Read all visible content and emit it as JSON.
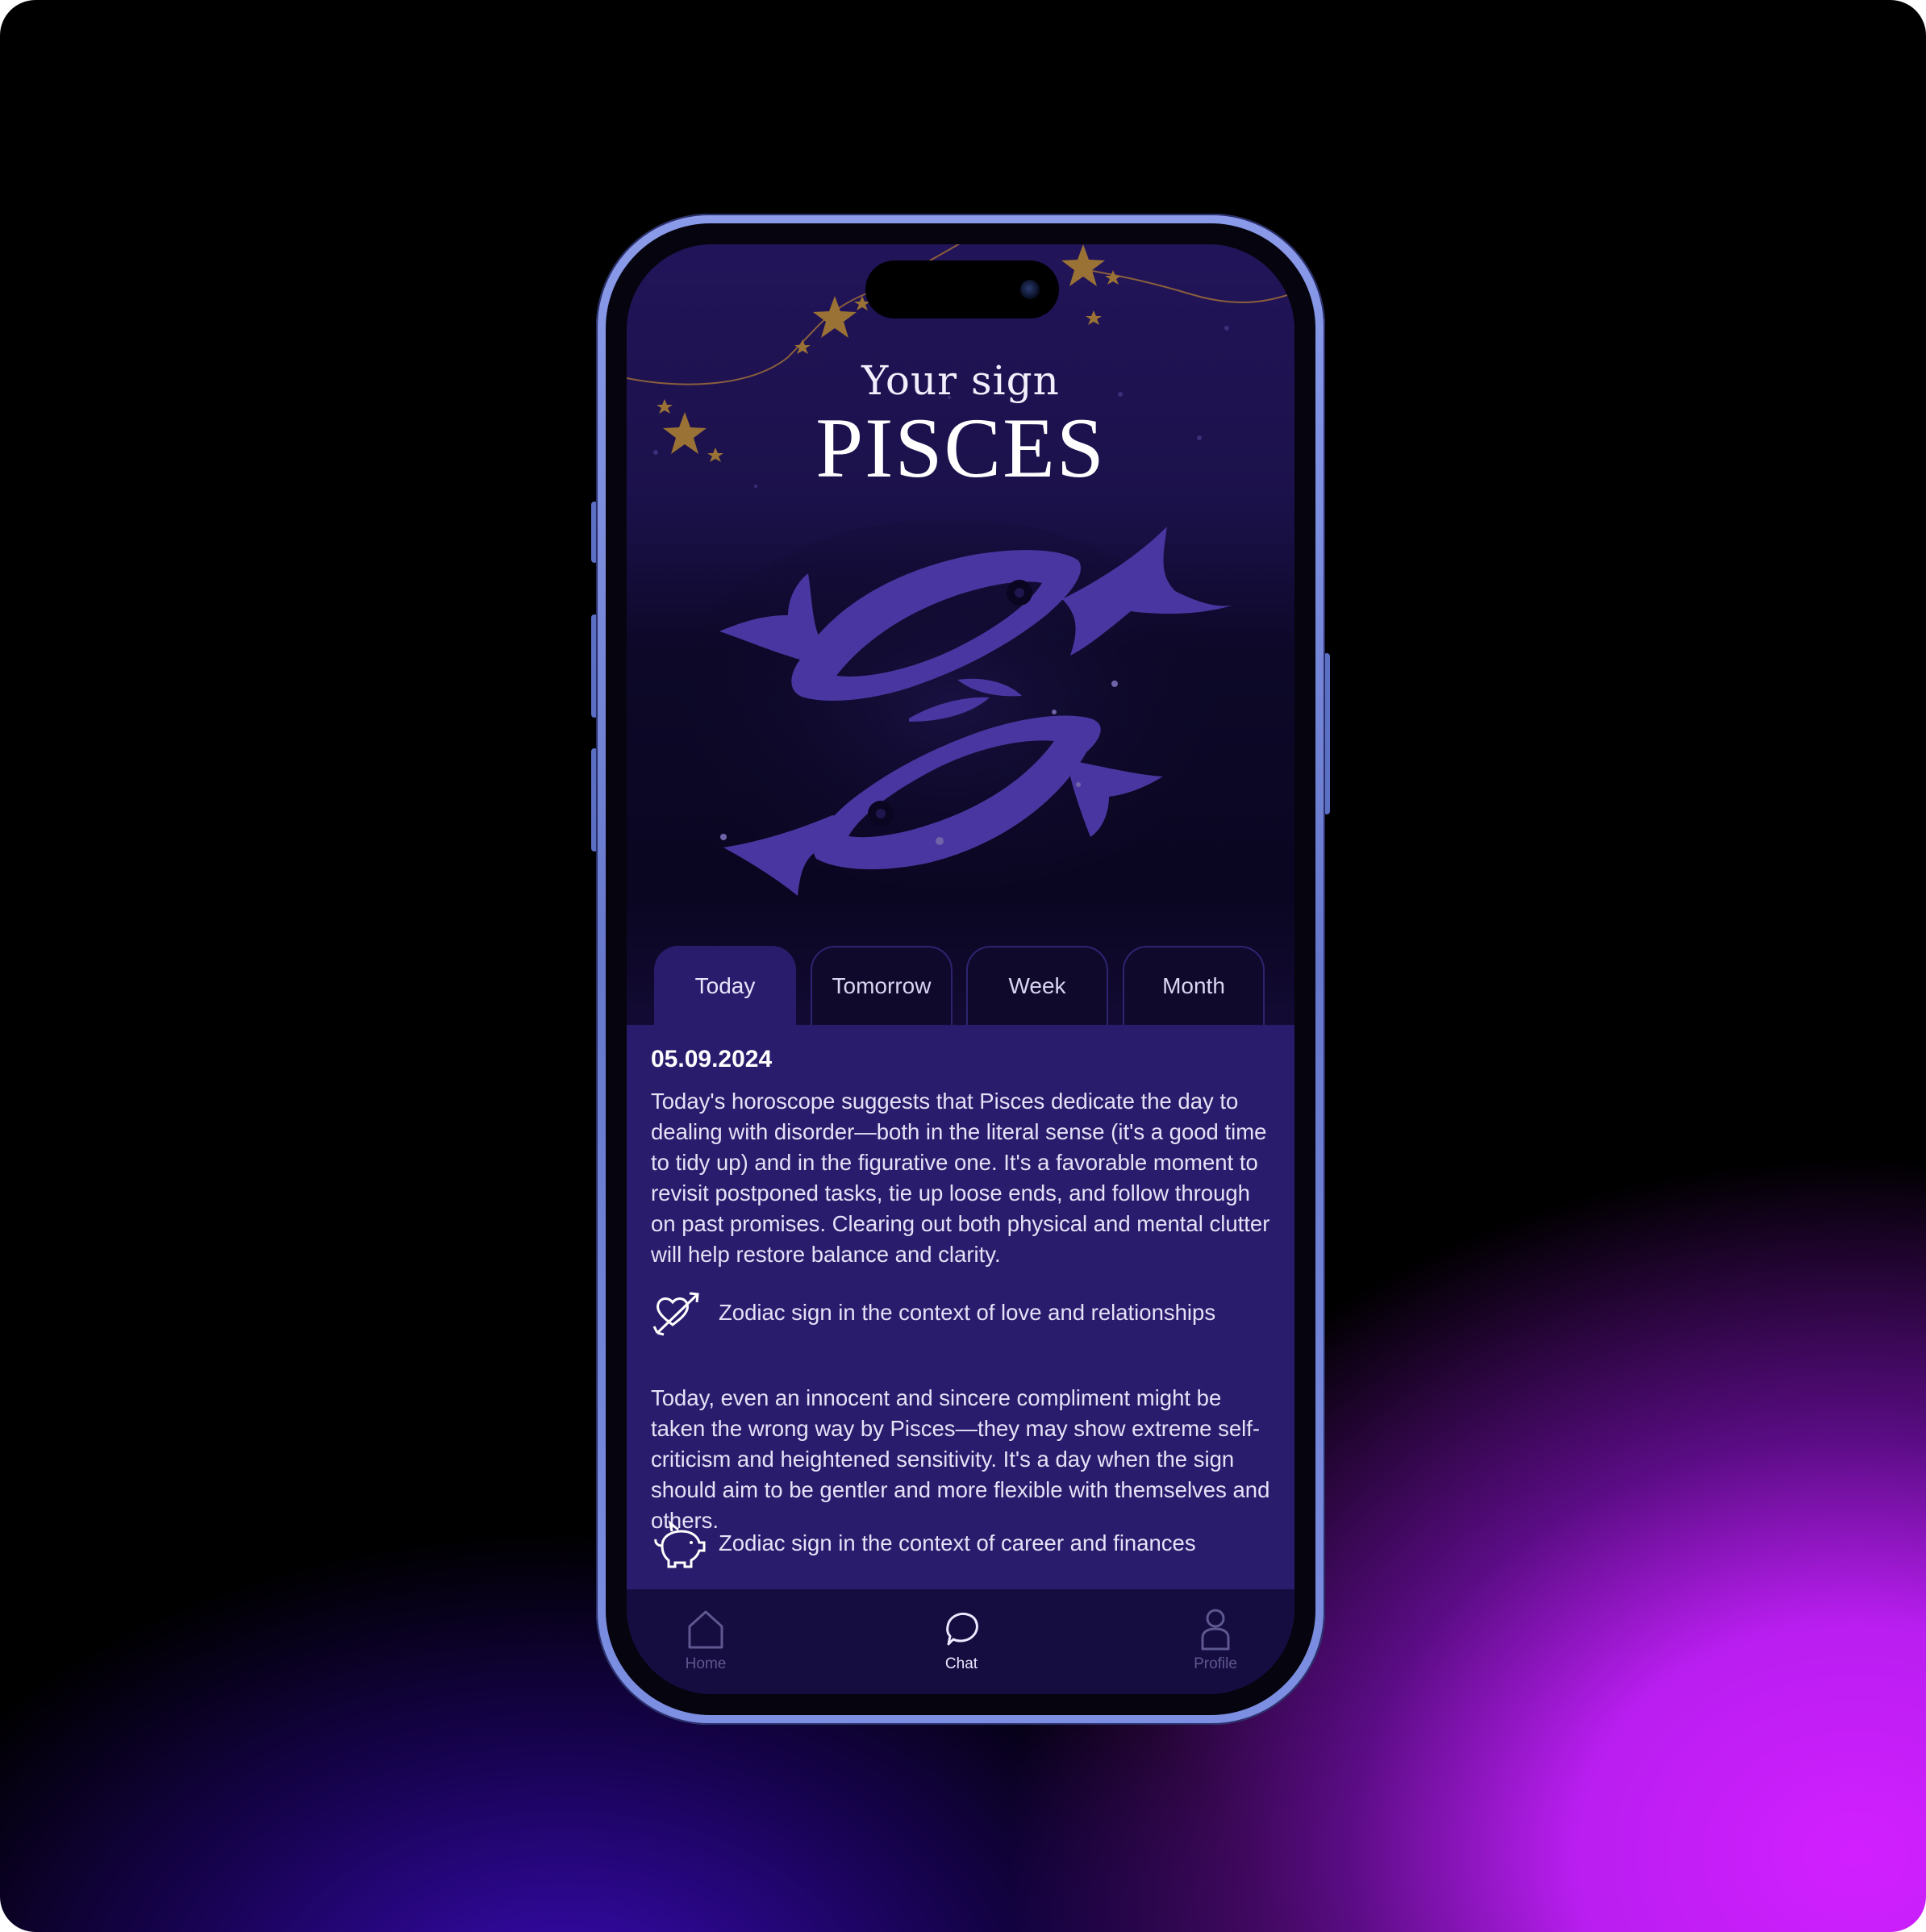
{
  "header": {
    "subtitle": "Your sign",
    "sign": "PISCES"
  },
  "tabs": [
    {
      "label": "Today",
      "active": true
    },
    {
      "label": "Tomorrow",
      "active": false
    },
    {
      "label": "Week",
      "active": false
    },
    {
      "label": "Month",
      "active": false
    }
  ],
  "horoscope": {
    "date": "05.09.2024",
    "paragraph_1": "Today's horoscope suggests that Pisces dedicate the day to dealing with disorder—both in the literal sense (it's a good time to tidy up) and in the figurative one. It's a favorable moment to revisit postponed tasks, tie up loose ends, and follow through on past promises. Clearing out both physical and mental clutter will help restore balance and clarity.",
    "love_label": "Zodiac sign in the context of love and relationships",
    "paragraph_2": "Today, even an innocent and sincere compliment might be taken the wrong way by Pisces—they may show extreme self-criticism and heightened sensitivity. It's a day when the sign should aim to be gentler and more flexible with themselves and others.",
    "career_label": "Zodiac sign in the context of career and finances"
  },
  "bottom_nav": {
    "home": "Home",
    "chat": "Chat",
    "profile": "Profile",
    "active": "chat"
  },
  "icons": {
    "love": "heart-arrow-icon",
    "career": "piggy-bank-icon",
    "home": "home-icon",
    "chat": "chat-bubble-icon",
    "profile": "user-icon"
  },
  "colors": {
    "accent_purple": "#4a36a0",
    "content_bg": "#2a1c6c",
    "star_gold": "#9a7236",
    "nav_bg": "#150d40"
  }
}
